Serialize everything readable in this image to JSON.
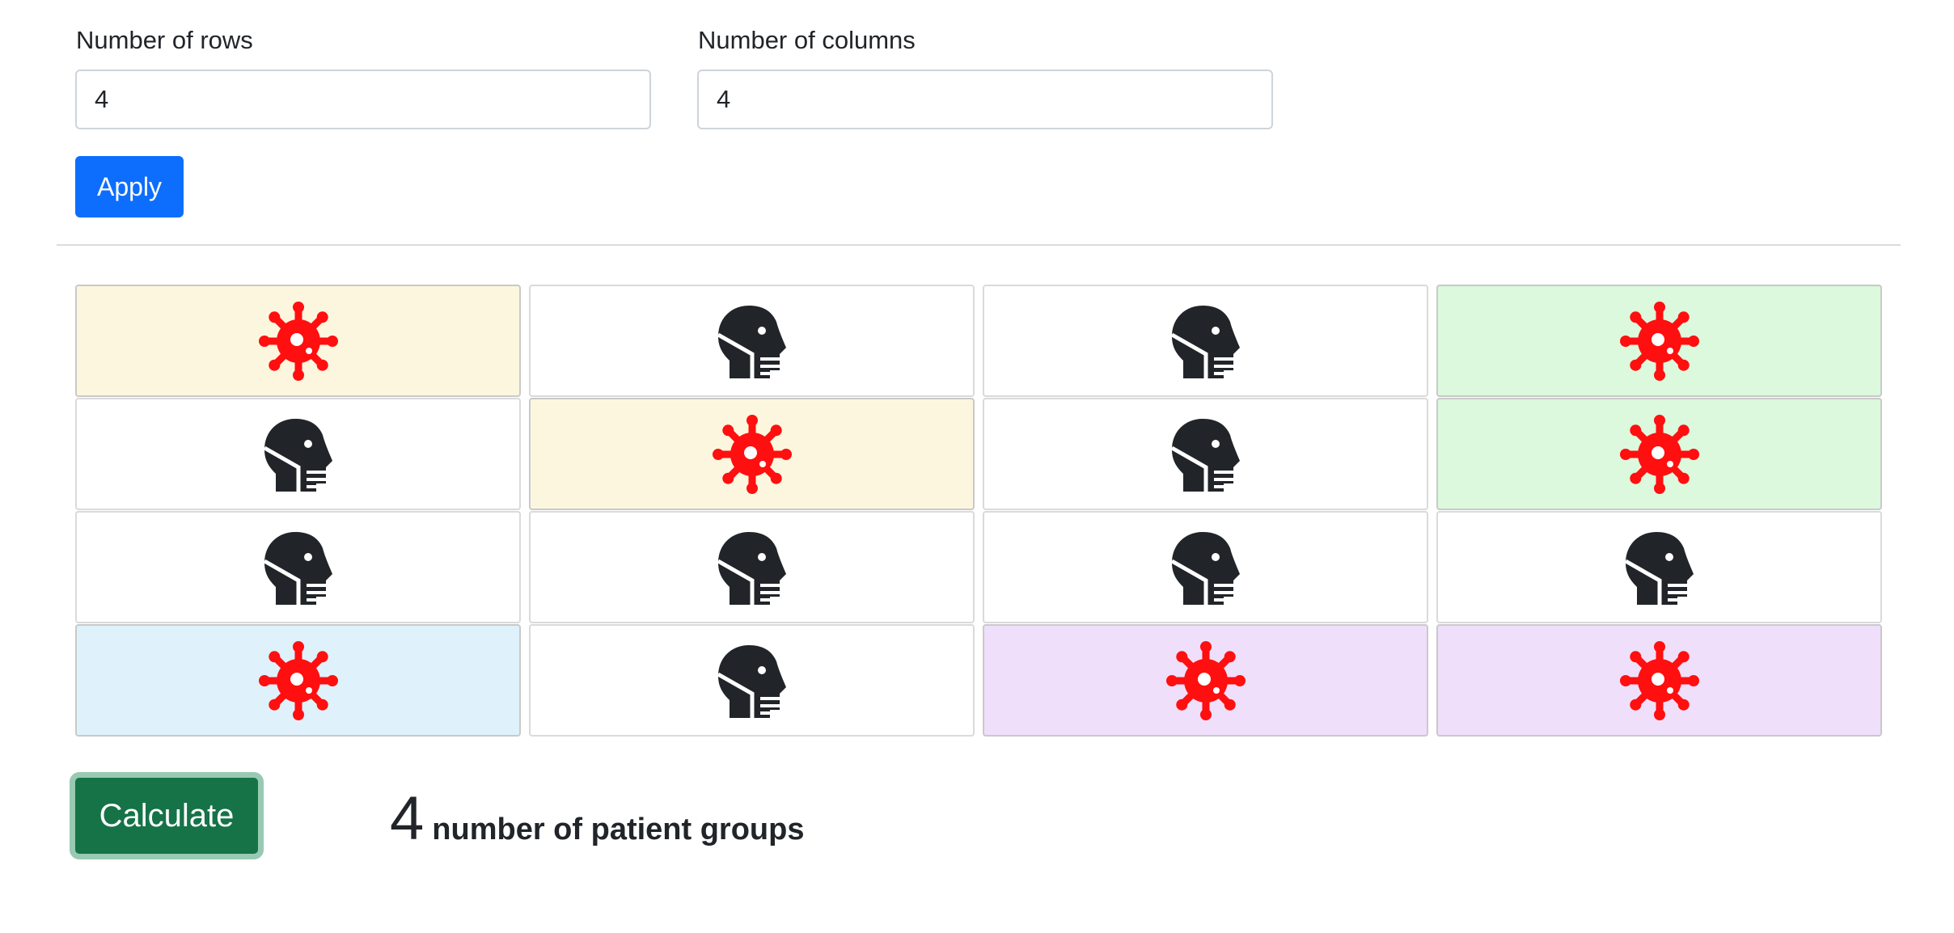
{
  "form": {
    "rows_label": "Number of rows",
    "rows_value": "4",
    "cols_label": "Number of columns",
    "cols_value": "4",
    "apply_label": "Apply"
  },
  "grid": {
    "rows": [
      [
        {
          "type": "virus",
          "color": "#fcf6df"
        },
        {
          "type": "person",
          "color": "#ffffff"
        },
        {
          "type": "person",
          "color": "#ffffff"
        },
        {
          "type": "virus",
          "color": "#dcf8dd"
        }
      ],
      [
        {
          "type": "person",
          "color": "#ffffff"
        },
        {
          "type": "virus",
          "color": "#fcf6df"
        },
        {
          "type": "person",
          "color": "#ffffff"
        },
        {
          "type": "virus",
          "color": "#dcf8dd"
        }
      ],
      [
        {
          "type": "person",
          "color": "#ffffff"
        },
        {
          "type": "person",
          "color": "#ffffff"
        },
        {
          "type": "person",
          "color": "#ffffff"
        },
        {
          "type": "person",
          "color": "#ffffff"
        }
      ],
      [
        {
          "type": "virus",
          "color": "#dff1fb"
        },
        {
          "type": "person",
          "color": "#ffffff"
        },
        {
          "type": "virus",
          "color": "#efdffb"
        },
        {
          "type": "virus",
          "color": "#efdffb"
        }
      ]
    ],
    "icon_names": {
      "virus": "virus-icon",
      "person": "head-side-mask-icon"
    },
    "icon_colors": {
      "virus": "#ff0f0f",
      "person": "#212529"
    }
  },
  "calculate": {
    "label": "Calculate"
  },
  "result": {
    "count": "4",
    "label": "number of patient groups"
  }
}
